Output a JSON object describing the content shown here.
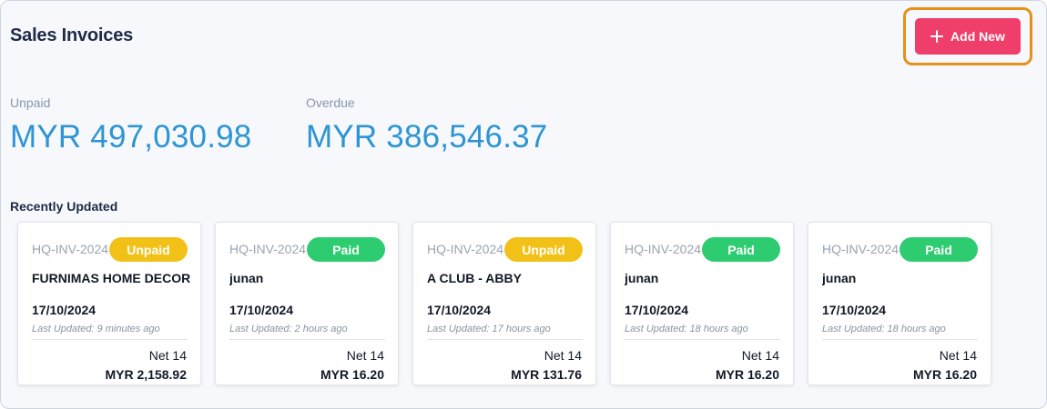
{
  "header": {
    "title": "Sales Invoices",
    "add_label": "Add New",
    "add_icon": "plus-icon",
    "highlight_color": "#e5901a",
    "button_color": "#ef3e6a"
  },
  "stats": {
    "unpaid": {
      "label": "Unpaid",
      "value": "MYR 497,030.98"
    },
    "overdue": {
      "label": "Overdue",
      "value": "MYR 386,546.37"
    }
  },
  "recent": {
    "title": "Recently Updated",
    "cards": [
      {
        "invoice_no": "HQ-INV-2024",
        "status": "Unpaid",
        "customer": "FURNIMAS HOME DECOR",
        "date": "17/10/2024",
        "updated": "Last Updated: 9 minutes ago",
        "terms": "Net 14",
        "amount": "MYR 2,158.92"
      },
      {
        "invoice_no": "HQ-INV-2024",
        "status": "Paid",
        "customer": "junan",
        "date": "17/10/2024",
        "updated": "Last Updated: 2 hours ago",
        "terms": "Net 14",
        "amount": "MYR 16.20"
      },
      {
        "invoice_no": "HQ-INV-2024",
        "status": "Unpaid",
        "customer": "A CLUB - ABBY",
        "date": "17/10/2024",
        "updated": "Last Updated: 17 hours ago",
        "terms": "Net 14",
        "amount": "MYR 131.76"
      },
      {
        "invoice_no": "HQ-INV-2024",
        "status": "Paid",
        "customer": "junan",
        "date": "17/10/2024",
        "updated": "Last Updated: 18 hours ago",
        "terms": "Net 14",
        "amount": "MYR 16.20"
      },
      {
        "invoice_no": "HQ-INV-2024",
        "status": "Paid",
        "customer": "junan",
        "date": "17/10/2024",
        "updated": "Last Updated: 18 hours ago",
        "terms": "Net 14",
        "amount": "MYR 16.20"
      }
    ]
  },
  "status_colors": {
    "Unpaid": "#f2c118",
    "Paid": "#2ecc71"
  },
  "stat_value_color": "#2d95d3"
}
